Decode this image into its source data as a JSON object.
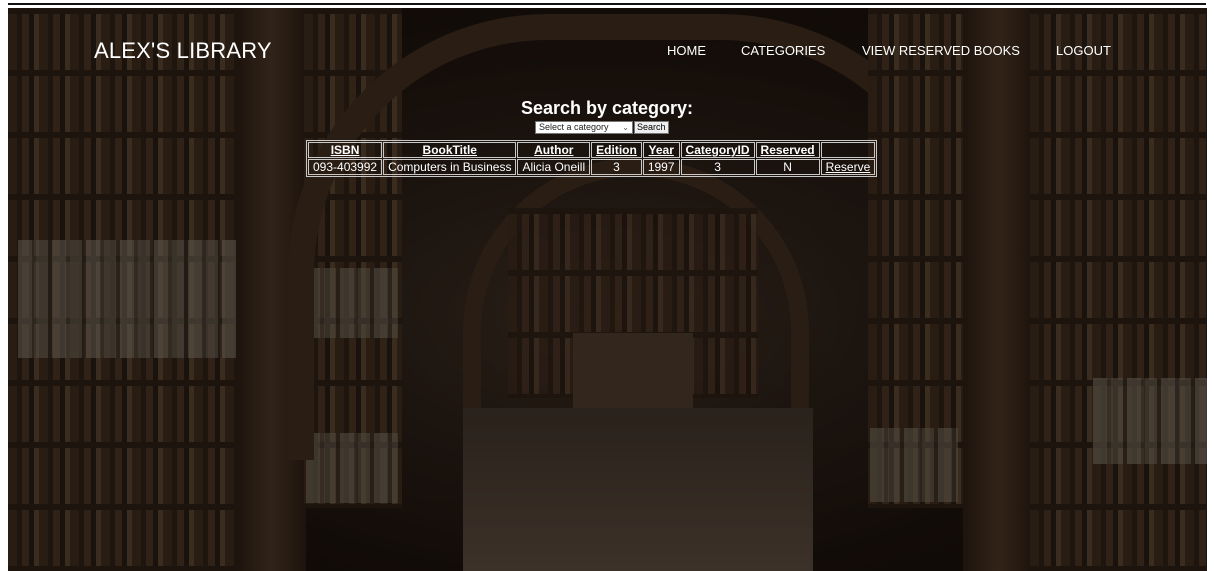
{
  "brand": "ALEX'S LIBRARY",
  "nav": {
    "home": "HOME",
    "categories": "CATEGORIES",
    "reserved": "VIEW RESERVED BOOKS",
    "logout": "LOGOUT"
  },
  "search": {
    "title": "Search by category:",
    "select_value": "Select a category",
    "button": "Search"
  },
  "table": {
    "headers": [
      "ISBN",
      "BookTitle",
      "Author",
      "Edition",
      "Year",
      "CategoryID",
      "Reserved"
    ],
    "rows": [
      {
        "isbn": "093-403992",
        "title": "Computers in Business",
        "author": "Alicia Oneill",
        "edition": "3",
        "year": "1997",
        "category_id": "3",
        "reserved": "N",
        "action": "Reserve"
      }
    ]
  }
}
